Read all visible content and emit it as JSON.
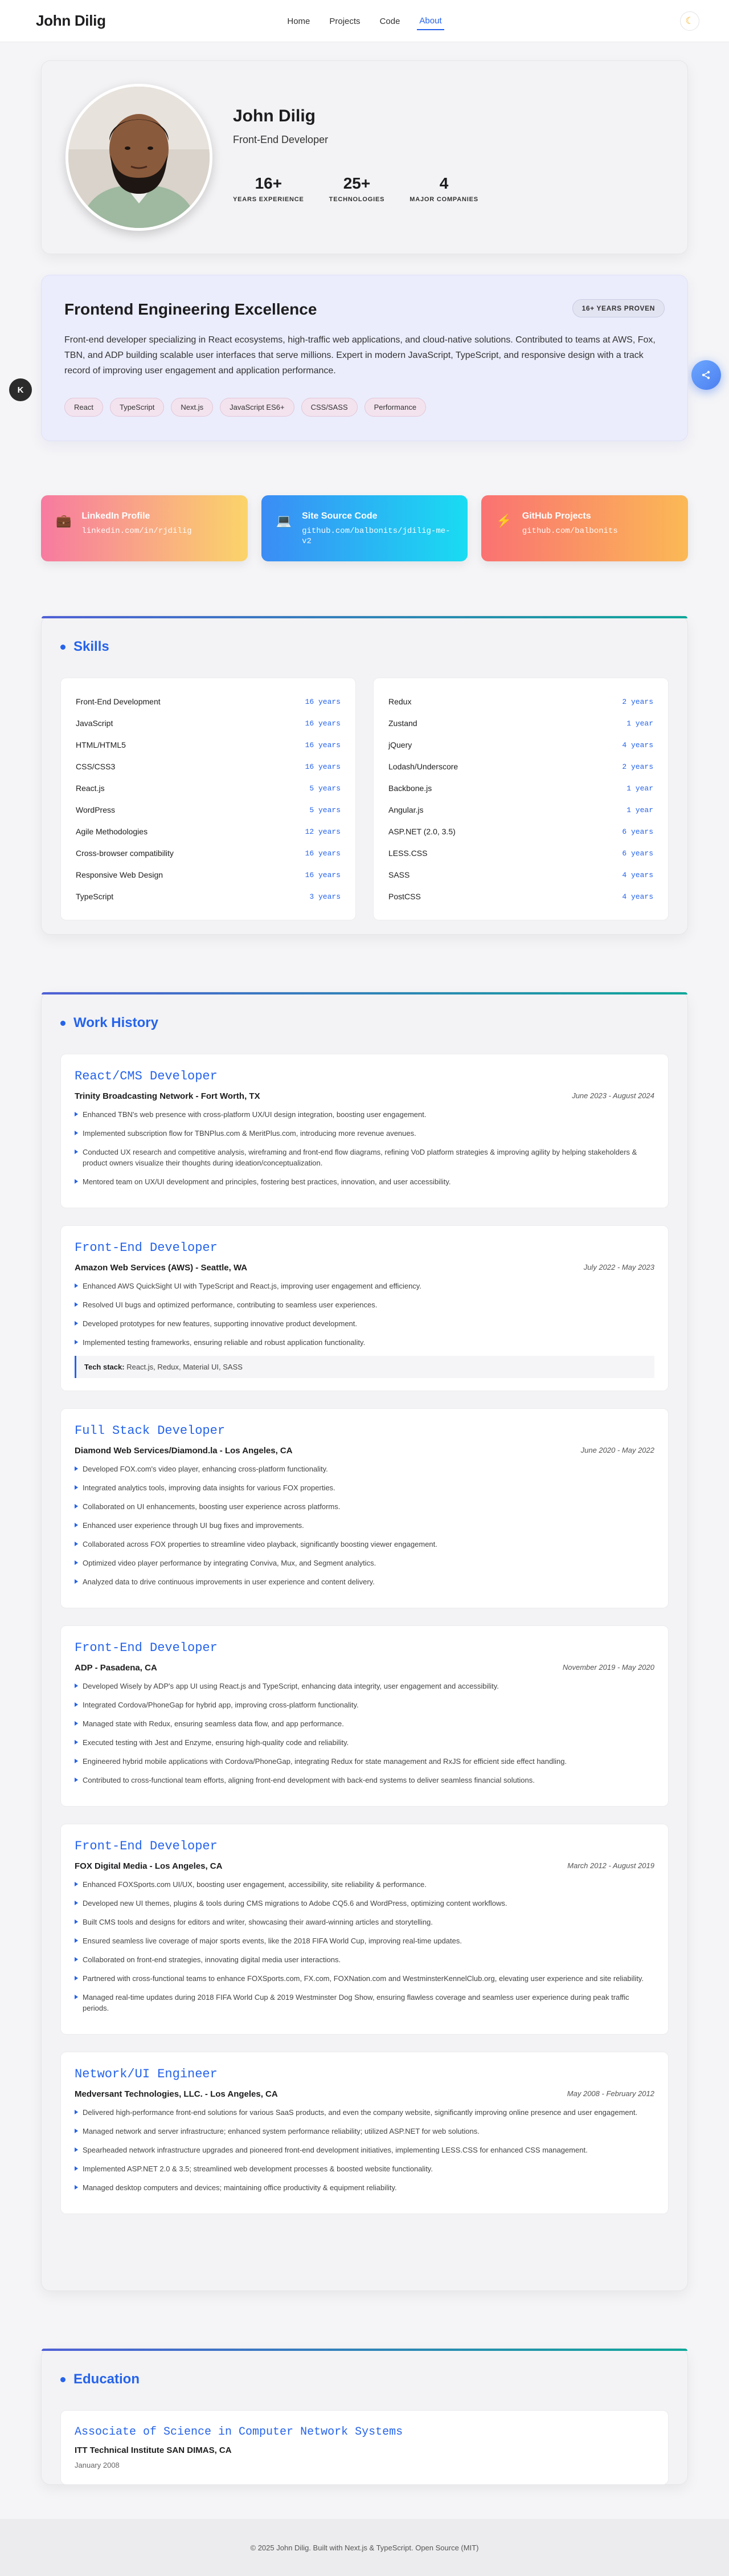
{
  "nav": {
    "brand": "John Dilig",
    "links": [
      "Home",
      "Projects",
      "Code",
      "About"
    ],
    "active": "About",
    "theme_icon": "moon-icon"
  },
  "hero": {
    "name": "John Dilig",
    "title": "Front-End Developer",
    "stats": [
      {
        "value": "16+",
        "label": "YEARS EXPERIENCE"
      },
      {
        "value": "25+",
        "label": "TECHNOLOGIES"
      },
      {
        "value": "4",
        "label": "MAJOR COMPANIES"
      }
    ]
  },
  "excellence": {
    "title": "Frontend Engineering Excellence",
    "badge": "16+ YEARS PROVEN",
    "text": "Front-end developer specializing in React ecosystems, high-traffic web applications, and cloud-native solutions. Contributed to teams at AWS, Fox, TBN, and ADP building scalable user interfaces that serve millions. Expert in modern JavaScript, TypeScript, and responsive design with a track record of improving user engagement and application performance.",
    "chips": [
      "React",
      "TypeScript",
      "Next.js",
      "JavaScript ES6+",
      "CSS/SASS",
      "Performance"
    ]
  },
  "side": {
    "k_label": "K"
  },
  "links": [
    {
      "title": "LinkedIn Profile",
      "sub": "linkedin.com/in/rjdilig",
      "icon": "briefcase-icon"
    },
    {
      "title": "Site Source Code",
      "sub": "github.com/balbonits/jdilig-me-v2",
      "icon": "laptop-icon"
    },
    {
      "title": "GitHub Projects",
      "sub": "github.com/balbonits",
      "icon": "lightning-icon"
    }
  ],
  "skills": {
    "heading": "Skills",
    "left": [
      {
        "name": "Front-End Development",
        "years": "16 years"
      },
      {
        "name": "JavaScript",
        "years": "16 years"
      },
      {
        "name": "HTML/HTML5",
        "years": "16 years"
      },
      {
        "name": "CSS/CSS3",
        "years": "16 years"
      },
      {
        "name": "React.js",
        "years": "5 years"
      },
      {
        "name": "WordPress",
        "years": "5 years"
      },
      {
        "name": "Agile Methodologies",
        "years": "12 years"
      },
      {
        "name": "Cross-browser compatibility",
        "years": "16 years"
      },
      {
        "name": "Responsive Web Design",
        "years": "16 years"
      },
      {
        "name": "TypeScript",
        "years": "3 years"
      }
    ],
    "right": [
      {
        "name": "Redux",
        "years": "2 years"
      },
      {
        "name": "Zustand",
        "years": "1 year"
      },
      {
        "name": "jQuery",
        "years": "4 years"
      },
      {
        "name": "Lodash/Underscore",
        "years": "2 years"
      },
      {
        "name": "Backbone.js",
        "years": "1 year"
      },
      {
        "name": "Angular.js",
        "years": "1 year"
      },
      {
        "name": "ASP.NET (2.0, 3.5)",
        "years": "6 years"
      },
      {
        "name": "LESS.CSS",
        "years": "6 years"
      },
      {
        "name": "SASS",
        "years": "4 years"
      },
      {
        "name": "PostCSS",
        "years": "4 years"
      }
    ]
  },
  "work": {
    "heading": "Work History",
    "jobs": [
      {
        "title": "React/CMS Developer",
        "company": "Trinity Broadcasting Network - Fort Worth, TX",
        "dates": "June 2023 - August 2024",
        "bullets": [
          "Enhanced TBN's web presence with cross-platform UX/UI design integration, boosting user engagement.",
          "Implemented subscription flow for TBNPlus.com & MeritPlus.com, introducing more revenue avenues.",
          "Conducted UX research and competitive analysis, wireframing and front-end flow diagrams, refining VoD platform strategies & improving agility by helping stakeholders & product owners visualize their thoughts during ideation/conceptualization.",
          "Mentored team on UX/UI development and principles, fostering best practices, innovation, and user accessibility."
        ]
      },
      {
        "title": "Front-End Developer",
        "company": "Amazon Web Services (AWS) - Seattle, WA",
        "dates": "July 2022 - May 2023",
        "bullets": [
          "Enhanced AWS QuickSight UI with TypeScript and React.js, improving user engagement and efficiency.",
          "Resolved UI bugs and optimized performance, contributing to seamless user experiences.",
          "Developed prototypes for new features, supporting innovative product development.",
          "Implemented testing frameworks, ensuring reliable and robust application functionality."
        ],
        "tech_label": "Tech stack:",
        "tech": "React.js, Redux, Material UI, SASS"
      },
      {
        "title": "Full Stack Developer",
        "company": "Diamond Web Services/Diamond.la - Los Angeles, CA",
        "dates": "June 2020 - May 2022",
        "bullets": [
          "Developed FOX.com's video player, enhancing cross-platform functionality.",
          "Integrated analytics tools, improving data insights for various FOX properties.",
          "Collaborated on UI enhancements, boosting user experience across platforms.",
          "Enhanced user experience through UI bug fixes and improvements.",
          "Collaborated across FOX properties to streamline video playback, significantly boosting viewer engagement.",
          "Optimized video player performance by integrating Conviva, Mux, and Segment analytics.",
          "Analyzed data to drive continuous improvements in user experience and content delivery."
        ]
      },
      {
        "title": "Front-End Developer",
        "company": "ADP - Pasadena, CA",
        "dates": "November 2019 - May 2020",
        "bullets": [
          "Developed Wisely by ADP's app UI using React.js and TypeScript, enhancing data integrity, user engagement and accessibility.",
          "Integrated Cordova/PhoneGap for hybrid app, improving cross-platform functionality.",
          "Managed state with Redux, ensuring seamless data flow, and app performance.",
          "Executed testing with Jest and Enzyme, ensuring high-quality code and reliability.",
          "Engineered hybrid mobile applications with Cordova/PhoneGap, integrating Redux for state management and RxJS for efficient side effect handling.",
          "Contributed to cross-functional team efforts, aligning front-end development with back-end systems to deliver seamless financial solutions."
        ]
      },
      {
        "title": "Front-End Developer",
        "company": "FOX Digital Media - Los Angeles, CA",
        "dates": "March 2012 - August 2019",
        "bullets": [
          "Enhanced FOXSports.com UI/UX, boosting user engagement, accessibility, site reliability & performance.",
          "Developed new UI themes, plugins & tools during CMS migrations to Adobe CQ5.6 and WordPress, optimizing content workflows.",
          "Built CMS tools and designs for editors and writer, showcasing their award-winning articles and storytelling.",
          "Ensured seamless live coverage of major sports events, like the 2018 FIFA World Cup, improving real-time updates.",
          "Collaborated on front-end strategies, innovating digital media user interactions.",
          "Partnered with cross-functional teams to enhance FOXSports.com, FX.com, FOXNation.com and WestminsterKennelClub.org, elevating user experience and site reliability.",
          "Managed real-time updates during 2018 FIFA World Cup & 2019 Westminster Dog Show, ensuring flawless coverage and seamless user experience during peak traffic periods."
        ]
      },
      {
        "title": "Network/UI Engineer",
        "company": "Medversant Technologies, LLC. - Los Angeles, CA",
        "dates": "May 2008 - February 2012",
        "bullets": [
          "Delivered high-performance front-end solutions for various SaaS products, and even the company website, significantly improving online presence and user engagement.",
          "Managed network and server infrastructure; enhanced system performance reliability; utilized ASP.NET for web solutions.",
          "Spearheaded network infrastructure upgrades and pioneered front-end development initiatives, implementing LESS.CSS for enhanced CSS management.",
          "Implemented ASP.NET 2.0 & 3.5; streamlined web development processes & boosted website functionality.",
          "Managed desktop computers and devices; maintaining office productivity & equipment reliability."
        ]
      }
    ]
  },
  "education": {
    "heading": "Education",
    "degree": "Associate of Science in Computer Network Systems",
    "school": "ITT Technical Institute SAN DIMAS, CA",
    "date": "January 2008"
  },
  "footer": {
    "text": "© 2025 John Dilig. Built with Next.js & TypeScript. Open Source (MIT)"
  }
}
